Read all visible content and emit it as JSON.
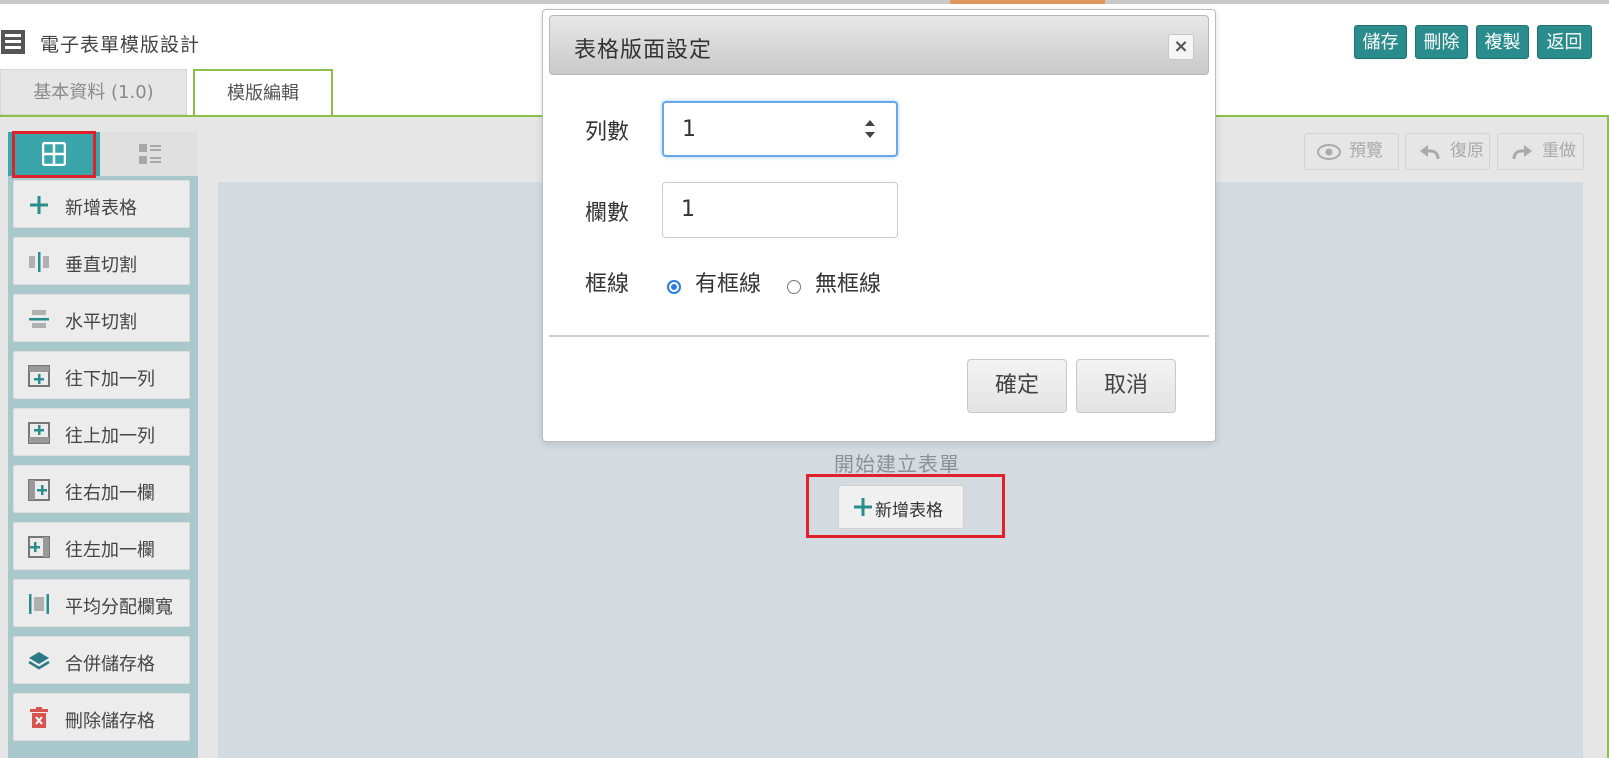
{
  "app": {
    "title": "電子表單模版設計",
    "icon": "form-layout-icon"
  },
  "header_buttons": [
    {
      "label": "儲存"
    },
    {
      "label": "刪除"
    },
    {
      "label": "複製"
    },
    {
      "label": "返回"
    }
  ],
  "tabs": [
    {
      "label": "基本資料 (1.0)"
    },
    {
      "label": "模版編輯"
    }
  ],
  "sidebar": {
    "tab_icons": [
      "grid-icon",
      "list-icon"
    ],
    "items": [
      {
        "label": "新增表格",
        "icon": "plus-icon"
      },
      {
        "label": "垂直切割",
        "icon": "vertical-split-icon"
      },
      {
        "label": "水平切割",
        "icon": "horizontal-split-icon"
      },
      {
        "label": "往下加一列",
        "icon": "add-row-below-icon"
      },
      {
        "label": "往上加一列",
        "icon": "add-row-above-icon"
      },
      {
        "label": "往右加一欄",
        "icon": "add-column-right-icon"
      },
      {
        "label": "往左加一欄",
        "icon": "add-column-left-icon"
      },
      {
        "label": "平均分配欄寬",
        "icon": "distribute-columns-icon"
      },
      {
        "label": "合併儲存格",
        "icon": "merge-cells-icon"
      },
      {
        "label": "刪除儲存格",
        "icon": "trash-icon"
      }
    ]
  },
  "toolbar": {
    "preview": "預覽",
    "undo": "復原",
    "redo": "重做"
  },
  "canvas": {
    "start_label": "開始建立表單",
    "add_table_button": "新增表格"
  },
  "modal": {
    "title": "表格版面設定",
    "rows_label": "列數",
    "rows_value": "1",
    "cols_label": "欄數",
    "cols_value": "1",
    "border_label": "框線",
    "border_on_label": "有框線",
    "border_off_label": "無框線",
    "border_selected": "有框線",
    "confirm": "確定",
    "cancel": "取消"
  },
  "colors": {
    "accent_teal": "#2a8c8c",
    "tab_green": "#8cc04a",
    "highlight_red": "#e0202a",
    "canvas_bg": "#d3dbe1"
  }
}
